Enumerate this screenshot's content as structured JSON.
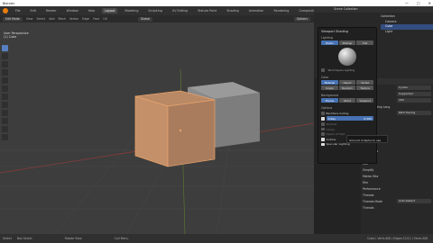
{
  "window": {
    "title": "Blender",
    "controls": [
      "—",
      "▢",
      "✕"
    ]
  },
  "menubar": {
    "menus": [
      "File",
      "Edit",
      "Render",
      "Window",
      "Help"
    ],
    "workspace_tabs": [
      "Layout",
      "Modeling",
      "Sculpting",
      "UV Editing",
      "Texture Paint",
      "Shading",
      "Animation",
      "Rendering",
      "Compositing",
      "Geometry Nodes",
      "Scripting"
    ],
    "active_tab": 0,
    "scene": "Scene",
    "view_layer": "View Layer"
  },
  "viewport": {
    "mode": "Edit Mode",
    "menus": [
      "View",
      "Select",
      "Add",
      "Mesh",
      "Vertex",
      "Edge",
      "Face",
      "UV"
    ],
    "orientation": "Global",
    "overlay_info_line1": "User Perspective",
    "overlay_info_line2": "(1) Cube",
    "options_label": "Options"
  },
  "shading_popup": {
    "title": "Viewport Shading",
    "lighting_label": "Lighting",
    "lighting_options": [
      "Studio",
      "MatCap",
      "Flat"
    ],
    "lighting_active": 0,
    "world_space_label": "World Space Lighting",
    "color_label": "Color",
    "color_options": [
      "Material",
      "Object",
      "Vertex",
      "Single",
      "Random",
      "Texture"
    ],
    "color_active": 0,
    "background_label": "Background",
    "background_options": [
      "Theme",
      "World",
      "Viewport"
    ],
    "background_active": 0,
    "options_label": "Options",
    "backface_culling": "Backface Culling",
    "xray_label": "X-Ray",
    "xray_value": "0.500",
    "shadow": "Shadow",
    "cavity": "Cavity",
    "dof": "Depth of Field",
    "outline": "Outline",
    "specular": "Specular Lighting",
    "accent": "#4772b3"
  },
  "tooltip": {
    "text": "Amount of alpha to use"
  },
  "outliner": {
    "header": "Scene Collection",
    "items": [
      "Collection",
      "Camera",
      "Cube",
      "Light"
    ],
    "selected": 2
  },
  "properties": {
    "rows": [
      {
        "label": "",
        "value": "Cycles"
      },
      {
        "label": "",
        "value": "Supported"
      },
      {
        "label": "",
        "value": "CPU"
      },
      {
        "label": "Open Shading Lang",
        "value": ""
      },
      {
        "label": "",
        "value": "Path Tracing"
      },
      {
        "label": "",
        "value": ""
      },
      {
        "label": "",
        "value": ""
      },
      {
        "label": "",
        "value": ""
      },
      {
        "label": "Denoising",
        "value": ""
      },
      {
        "label": "Advanced",
        "value": ""
      },
      {
        "label": "Light Paths",
        "value": ""
      },
      {
        "label": "Volumes",
        "value": ""
      },
      {
        "label": "Hair",
        "value": ""
      },
      {
        "label": "Simplify",
        "value": ""
      },
      {
        "label": "Motion Blur",
        "value": ""
      },
      {
        "label": "Film",
        "value": ""
      },
      {
        "label": "Performance",
        "value": ""
      },
      {
        "label": "Threads",
        "value": ""
      },
      {
        "label": "Threads Mode",
        "value": "Auto-Detect"
      },
      {
        "label": "Threads",
        "value": ""
      }
    ],
    "sampling_label": "Sampling"
  },
  "statusbar": {
    "items": [
      "Select",
      "Box Select",
      "Rotate View",
      "Call Menu"
    ],
    "stats": "Cube | Verts:8/8 | Edges:12/12 | Faces:6/6"
  },
  "colors": {
    "edit_orange": "#e8a36a",
    "grid": "#494949"
  }
}
